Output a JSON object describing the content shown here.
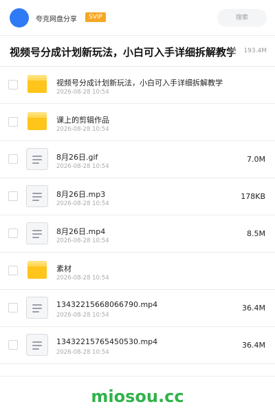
{
  "header": {
    "share_name": "夸克网盘分享",
    "badge": "SVIP",
    "search_placeholder": "搜索"
  },
  "folder": {
    "title": "视频号分成计划新玩法，小白可入手详细拆解教学",
    "total_size": "193.4M"
  },
  "files": [
    {
      "type": "folder",
      "name": "视频号分成计划新玩法，小白可入手详细拆解教学",
      "date": "2026-08-28 10:54",
      "size": ""
    },
    {
      "type": "folder",
      "name": "课上的剪辑作品",
      "date": "2026-08-28 10:54",
      "size": ""
    },
    {
      "type": "file",
      "name": "8月26日.gif",
      "date": "2026-08-28 10:54",
      "size": "7.0M"
    },
    {
      "type": "file",
      "name": "8月26日.mp3",
      "date": "2026-08-28 10:54",
      "size": "178KB"
    },
    {
      "type": "file",
      "name": "8月26日.mp4",
      "date": "2026-08-28 10:54",
      "size": "8.5M"
    },
    {
      "type": "folder",
      "name": "素材",
      "date": "2026-08-28 10:54",
      "size": ""
    },
    {
      "type": "file",
      "name": "13432215668066790.mp4",
      "date": "2026-08-28 10:54",
      "size": "36.4M"
    },
    {
      "type": "file",
      "name": "13432215765450530.mp4",
      "date": "2026-08-28 10:54",
      "size": "36.4M"
    }
  ],
  "watermark": "miosou.cc",
  "colors": {
    "accent": "#2f7bf5",
    "badge": "#f5a623",
    "folder": "#ffc51a",
    "watermark": "#2fb34a"
  }
}
